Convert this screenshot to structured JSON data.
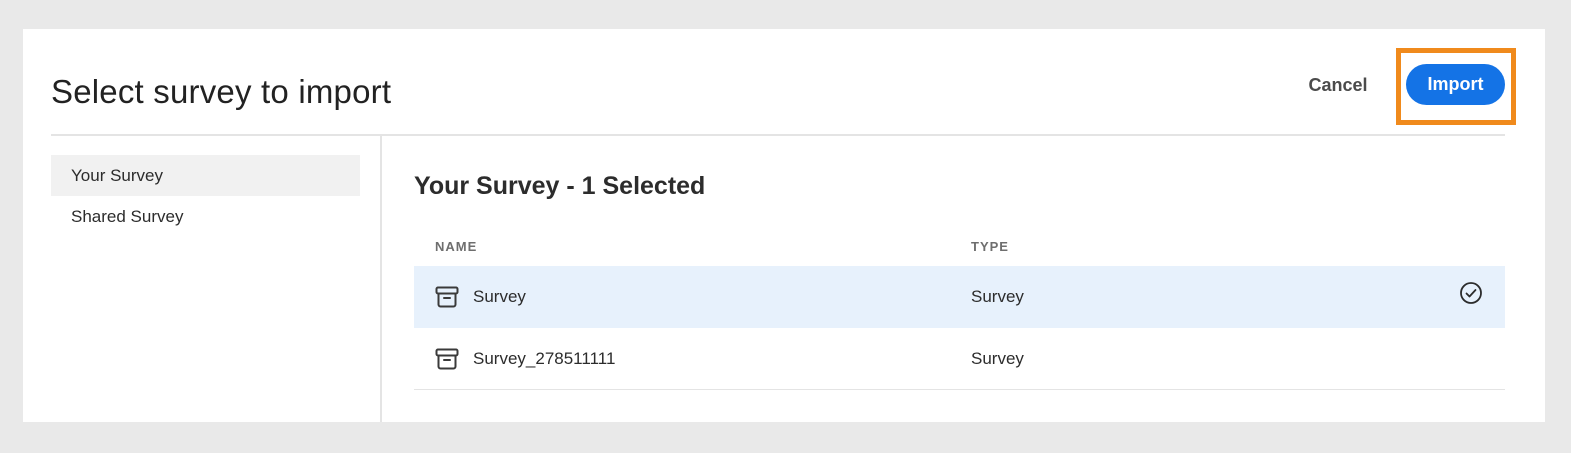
{
  "dialog": {
    "title": "Select survey to import",
    "cancel_label": "Cancel",
    "import_label": "Import"
  },
  "sidebar": {
    "items": [
      {
        "label": "Your Survey",
        "selected": true
      },
      {
        "label": "Shared Survey",
        "selected": false
      }
    ]
  },
  "main": {
    "section_title": "Your Survey - 1 Selected",
    "columns": {
      "name": "NAME",
      "type": "TYPE"
    },
    "rows": [
      {
        "name": "Survey",
        "type": "Survey",
        "selected": true,
        "icon": "archive-box-icon"
      },
      {
        "name": "Survey_278511111",
        "type": "Survey",
        "selected": false,
        "icon": "archive-box-icon"
      }
    ]
  },
  "colors": {
    "accent": "#1473e6",
    "highlight": "#f08a1c",
    "selected_row": "#e7f1fc"
  }
}
